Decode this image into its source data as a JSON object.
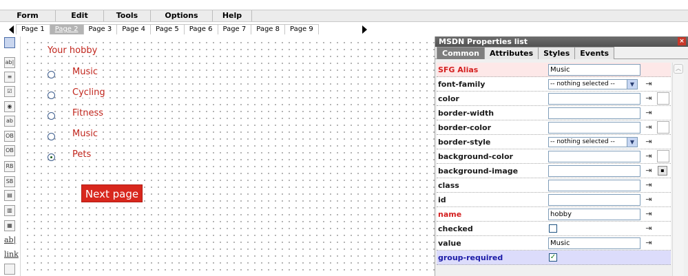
{
  "menu": [
    {
      "label": "Form"
    },
    {
      "label": "Edit"
    },
    {
      "label": "Tools"
    },
    {
      "label": "Options"
    },
    {
      "label": "Help"
    }
  ],
  "pages": [
    {
      "label": "Page 1",
      "active": false
    },
    {
      "label": "Page 2",
      "active": true
    },
    {
      "label": "Page 3",
      "active": false
    },
    {
      "label": "Page 4",
      "active": false
    },
    {
      "label": "Page 5",
      "active": false
    },
    {
      "label": "Page 6",
      "active": false
    },
    {
      "label": "Page 7",
      "active": false
    },
    {
      "label": "Page 8",
      "active": false
    },
    {
      "label": "Page 9",
      "active": false
    }
  ],
  "toolbar": {
    "tools": [
      {
        "icon": "select-pointer-icon"
      },
      {
        "icon": "text-field-icon",
        "glyph": "ab|"
      },
      {
        "icon": "textarea-icon",
        "glyph": "≡"
      },
      {
        "icon": "checkbox-icon",
        "glyph": "☑"
      },
      {
        "icon": "radio-icon",
        "glyph": "◉"
      },
      {
        "icon": "label-field-icon",
        "glyph": "ab"
      },
      {
        "icon": "option-button-1-icon",
        "glyph": "OB"
      },
      {
        "icon": "option-button-2-icon",
        "glyph": "OB"
      },
      {
        "icon": "reset-button-icon",
        "glyph": "RB"
      },
      {
        "icon": "submit-button-icon",
        "glyph": "SB"
      },
      {
        "icon": "select-box-icon",
        "glyph": "▤"
      },
      {
        "icon": "list-box-icon",
        "glyph": "▥"
      },
      {
        "icon": "combo-list-icon",
        "glyph": "▦"
      },
      {
        "icon": "text-label-icon",
        "glyph": "ab|"
      },
      {
        "icon": "link-icon",
        "glyph": "link"
      },
      {
        "icon": "box-icon",
        "glyph": ""
      }
    ]
  },
  "form": {
    "title": "Your hobby",
    "options": [
      {
        "label": "Music",
        "checked": false
      },
      {
        "label": "Cycling",
        "checked": false
      },
      {
        "label": "Fitness",
        "checked": false
      },
      {
        "label": "Music",
        "checked": false
      },
      {
        "label": "Pets",
        "checked": true
      }
    ],
    "next_button": "Next page"
  },
  "panel": {
    "title": "MSDN Properties list",
    "close_glyph": "×",
    "tabs": [
      {
        "label": "Common",
        "active": true
      },
      {
        "label": "Attributes",
        "active": false
      },
      {
        "label": "Styles",
        "active": false
      },
      {
        "label": "Events",
        "active": false
      }
    ],
    "rows": [
      {
        "label": "SFG Alias",
        "kind": "input",
        "value": "Music",
        "style": "red",
        "bg": "pink",
        "action": false,
        "color": false
      },
      {
        "label": "font-family",
        "kind": "select",
        "value": "-- nothing selected --",
        "style": "normal",
        "action": true,
        "color": false
      },
      {
        "label": "color",
        "kind": "input",
        "value": "",
        "style": "normal",
        "action": true,
        "color": true
      },
      {
        "label": "border-width",
        "kind": "input",
        "value": "",
        "style": "normal",
        "action": true,
        "color": false
      },
      {
        "label": "border-color",
        "kind": "input",
        "value": "",
        "style": "normal",
        "action": true,
        "color": true
      },
      {
        "label": "border-style",
        "kind": "select",
        "value": "-- nothing selected --",
        "style": "normal",
        "action": true,
        "color": false
      },
      {
        "label": "background-color",
        "kind": "input",
        "value": "",
        "style": "normal",
        "action": true,
        "color": true
      },
      {
        "label": "background-image",
        "kind": "input",
        "value": "",
        "style": "normal",
        "action": true,
        "image": true
      },
      {
        "label": "class",
        "kind": "input",
        "value": "",
        "style": "normal",
        "action": true
      },
      {
        "label": "id",
        "kind": "input",
        "value": "",
        "style": "normal",
        "action": true
      },
      {
        "label": "name",
        "kind": "input",
        "value": "hobby",
        "style": "red",
        "action": true
      },
      {
        "label": "checked",
        "kind": "checkbox",
        "checked": false,
        "style": "normal",
        "action": true
      },
      {
        "label": "value",
        "kind": "input",
        "value": "Music",
        "style": "normal",
        "action": true
      },
      {
        "label": "group-required",
        "kind": "checkbox",
        "checked": true,
        "style": "blue",
        "bg": "blue",
        "action": false
      }
    ]
  },
  "colors": {
    "form_text": "#c0251c",
    "next_button_bg": "#d8271d",
    "panel_title_bg": "#5c5c5c",
    "active_tab_bg": "#7e7e7e",
    "required_label": "#d42020",
    "group_required_label": "#1a1aa6"
  }
}
